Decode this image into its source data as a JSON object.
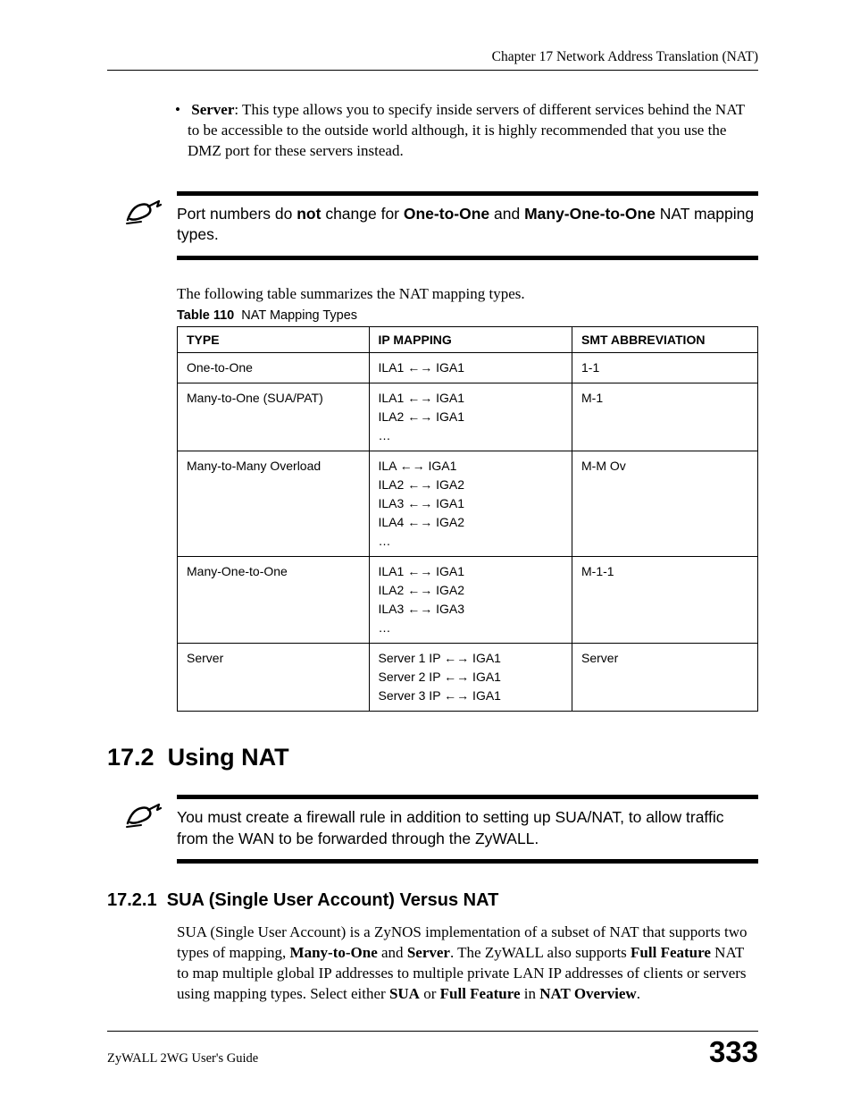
{
  "header": {
    "chapter_line": "Chapter 17 Network Address Translation (NAT)"
  },
  "bullet": {
    "label": "Server",
    "text": ": This type allows you to specify inside servers of different services behind the NAT to be accessible to the outside world although, it is highly recommended that you use the DMZ port for these servers instead."
  },
  "note1": {
    "pre": "Port numbers do ",
    "not": "not",
    "mid": " change for ",
    "t1": "One-to-One",
    "and": " and ",
    "t2": "Many-One-to-One",
    "post": " NAT mapping types."
  },
  "table_intro": "The following table summarizes the NAT mapping types.",
  "table_caption_num": "Table 110",
  "table_caption_title": "NAT Mapping Types",
  "table": {
    "headers": {
      "type": "TYPE",
      "map": "IP MAPPING",
      "abbr": "SMT ABBREVIATION"
    },
    "rows": [
      {
        "type": "One-to-One",
        "map_lines": [
          "ILA1 ←→ IGA1"
        ],
        "abbr": "1-1"
      },
      {
        "type": "Many-to-One (SUA/PAT)",
        "map_lines": [
          "ILA1 ←→ IGA1",
          "ILA2 ←→ IGA1",
          "…"
        ],
        "abbr": "M-1"
      },
      {
        "type": "Many-to-Many Overload",
        "map_lines": [
          "ILA ←→ IGA1",
          "ILA2 ←→ IGA2",
          "ILA3 ←→ IGA1",
          "ILA4 ←→ IGA2",
          "…"
        ],
        "abbr": "M-M Ov"
      },
      {
        "type": "Many-One-to-One",
        "map_lines": [
          "ILA1 ←→ IGA1",
          "ILA2 ←→ IGA2",
          "ILA3 ←→ IGA3",
          "…"
        ],
        "abbr": "M-1-1"
      },
      {
        "type": "Server",
        "map_lines": [
          "Server 1 IP ←→ IGA1",
          "Server 2 IP ←→ IGA1",
          "Server 3 IP ←→ IGA1"
        ],
        "abbr": "Server"
      }
    ]
  },
  "section17_2": {
    "num": "17.2",
    "title": "Using NAT"
  },
  "note2": {
    "text": "You must create a firewall rule in addition to setting up SUA/NAT, to allow traffic from the WAN to be forwarded through the ZyWALL."
  },
  "section17_2_1": {
    "num": "17.2.1",
    "title": "SUA (Single User Account) Versus NAT"
  },
  "sua_para": {
    "p1": "SUA (Single User Account) is a ZyNOS implementation of a subset of NAT that supports two types of mapping, ",
    "b1": "Many-to-One",
    "p2": " and ",
    "b2": "Server",
    "p3": ". The ZyWALL also supports ",
    "b3": "Full Feature",
    "p4": " NAT to map multiple global IP addresses to multiple private LAN IP addresses of clients or servers using mapping types. Select either ",
    "b4": "SUA",
    "p5": " or ",
    "b5": "Full Feature",
    "p6": " in ",
    "b6": "NAT Overview",
    "p7": "."
  },
  "footer": {
    "guide": "ZyWALL 2WG User's Guide",
    "page": "333"
  }
}
